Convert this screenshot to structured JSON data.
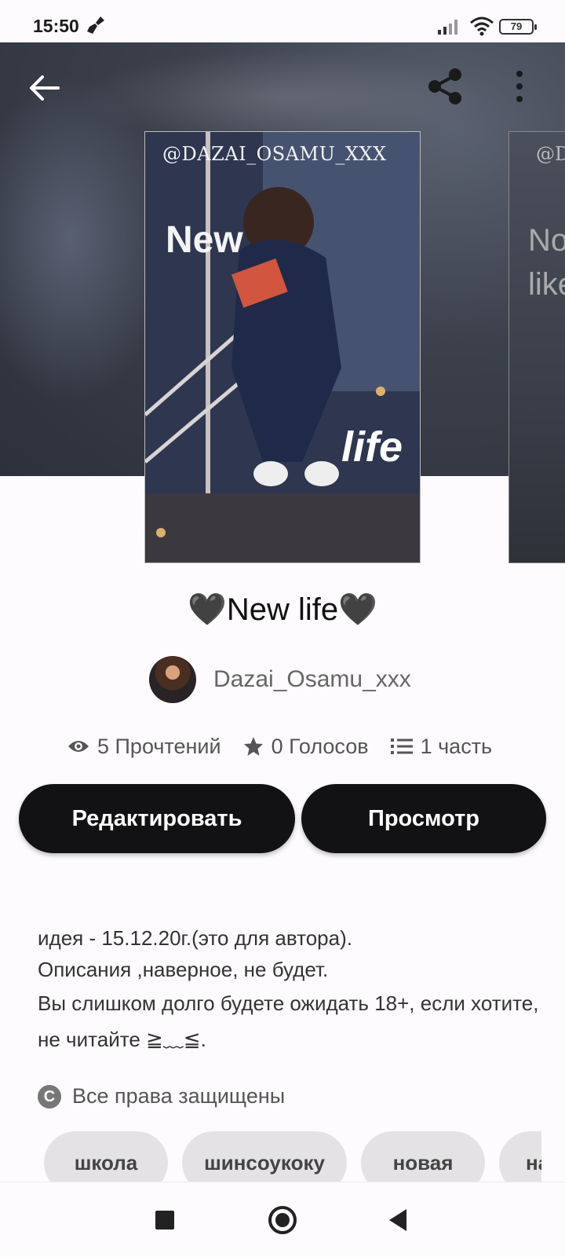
{
  "status_bar": {
    "time": "15:50",
    "battery": "79"
  },
  "toolbar": {
    "back_icon": "arrow-left-icon",
    "share_icon": "share-icon",
    "more_icon": "more-vertical-icon"
  },
  "cover": {
    "watermark": "@DAZAI_OSAMU_XXX",
    "word_new": "New",
    "word_life": "life",
    "next_watermark": "@D",
    "next_text_line1": "Not",
    "next_text_line2": "like"
  },
  "story": {
    "title": "🖤New life🖤",
    "author": "Dazai_Osamu_xxx"
  },
  "stats": {
    "reads": "5 Прочтений",
    "votes": "0 Голосов",
    "parts": "1 часть"
  },
  "actions": {
    "edit_label": "Редактировать",
    "view_label": "Просмотр"
  },
  "description": {
    "line1": "идея - 15.12.20г.(это для автора).",
    "line2": "Описания ,наверное, не будет.",
    "line3": "Вы слишком долго будете ожидать 18+, если хотите, не читайте ≧﹏≦."
  },
  "copyright": {
    "icon": "copyright-icon",
    "label": "Все права защищены"
  },
  "tags": [
    "школа",
    "шинсоукоку",
    "новая",
    "на"
  ],
  "colors": {
    "button_bg": "#121113",
    "tag_bg": "#e4e2e5",
    "hero_bg": "#3b404b"
  }
}
